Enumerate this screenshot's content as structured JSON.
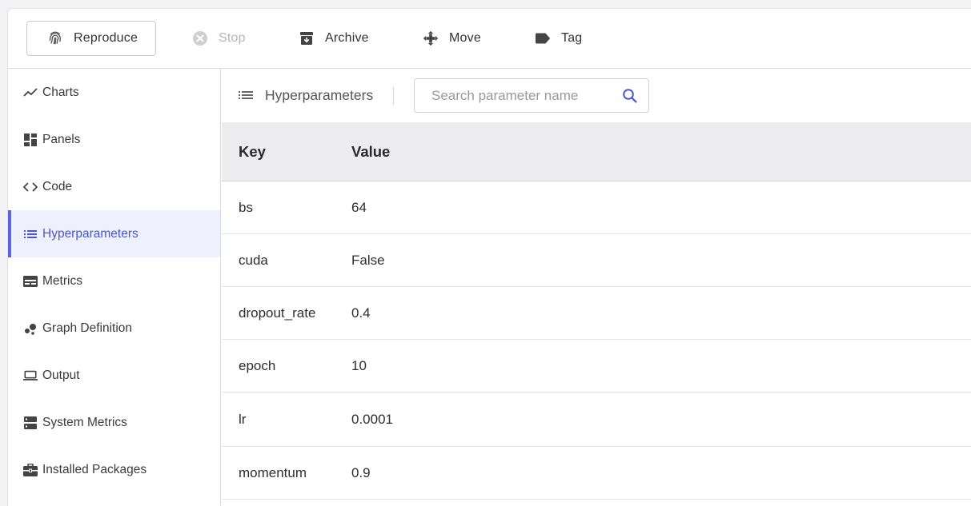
{
  "toolbar": {
    "reproduce": "Reproduce",
    "stop": "Stop",
    "archive": "Archive",
    "move": "Move",
    "tag": "Tag"
  },
  "sidebar": {
    "items": [
      {
        "label": "Charts",
        "icon": "chart-line-icon"
      },
      {
        "label": "Panels",
        "icon": "dashboard-icon"
      },
      {
        "label": "Code",
        "icon": "code-icon"
      },
      {
        "label": "Hyperparameters",
        "icon": "list-icon",
        "active": true
      },
      {
        "label": "Metrics",
        "icon": "metrics-icon"
      },
      {
        "label": "Graph Definition",
        "icon": "graph-icon"
      },
      {
        "label": "Output",
        "icon": "laptop-icon"
      },
      {
        "label": "System Metrics",
        "icon": "server-icon"
      },
      {
        "label": "Installed Packages",
        "icon": "briefcase-icon"
      }
    ]
  },
  "main": {
    "title": "Hyperparameters",
    "search": {
      "placeholder": "Search parameter name",
      "value": ""
    },
    "table": {
      "headers": [
        "Key",
        "Value"
      ],
      "rows": [
        {
          "key": "bs",
          "value": "64"
        },
        {
          "key": "cuda",
          "value": "False"
        },
        {
          "key": "dropout_rate",
          "value": "0.4"
        },
        {
          "key": "epoch",
          "value": "10"
        },
        {
          "key": "lr",
          "value": "0.0001"
        },
        {
          "key": "momentum",
          "value": "0.9"
        }
      ]
    }
  },
  "colors": {
    "accent": "#5b65dd",
    "active_bg": "#eef0fd",
    "header_bg": "#ededf0"
  }
}
